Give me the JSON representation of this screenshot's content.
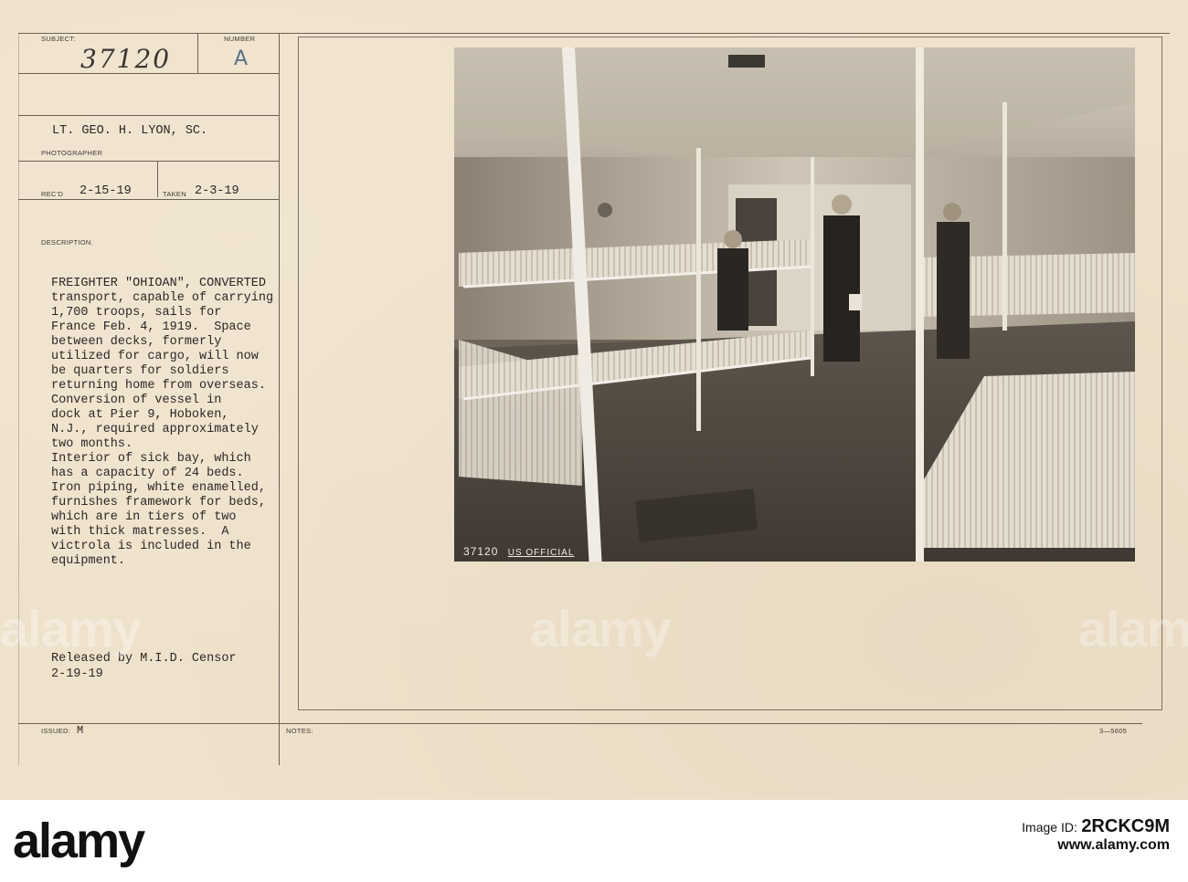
{
  "card": {
    "labels": {
      "subject": "SUBJECT:",
      "number": "NUMBER",
      "photographer": "PHOTOGRAPHER",
      "recd": "REC'D",
      "taken": "TAKEN",
      "description": "DESCRIPTION.",
      "issued": "ISSUED:",
      "notes": "NOTES:"
    },
    "subject_number": "37120",
    "number_value": "A",
    "photographer_name": "LT. GEO. H. LYON, SC.",
    "recd_date": "2-15-19",
    "taken_date": "2-3-19",
    "description_lines": [
      "FREIGHTER \"OHIOAN\", CONVERTED",
      "transport, capable of carrying",
      "1,700 troops, sails for",
      "France Feb. 4, 1919.  Space",
      "between decks, formerly",
      "utilized for cargo, will now",
      "be quarters for soldiers",
      "returning home from overseas.",
      "Conversion of vessel in",
      "dock at Pier 9, Hoboken,",
      "N.J., required approximately",
      "two months.",
      "Interior of sick bay, which",
      "has a capacity of 24 beds.",
      "Iron piping, white enamelled,",
      "furnishes framework for beds,",
      "which are in tiers of two",
      "with thick matresses.  A",
      "victrola is included in the",
      "equipment."
    ],
    "released_line": "Released by M.I.D. Censor",
    "released_date": "2-19-19",
    "issued_value": "M",
    "form_number": "3—5605"
  },
  "photo": {
    "negative_number": "37120",
    "stamp": "US OFFICIAL"
  },
  "watermarks": [
    "alamy",
    "alamy",
    "alamy"
  ],
  "footer": {
    "logo": "alamy",
    "image_id_label": "Image ID:",
    "image_id": "2RCKC9M",
    "url": "www.alamy.com"
  }
}
